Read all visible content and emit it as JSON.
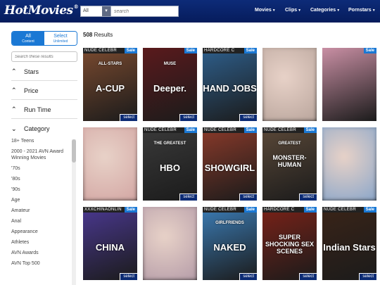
{
  "header": {
    "logo": "HotMovies",
    "logo_mark": "®",
    "search_scope": "All",
    "search_placeholder": "search",
    "nav": [
      "Movies",
      "Clips",
      "Categories",
      "Pornstars"
    ]
  },
  "sidebar": {
    "tab_all": "All",
    "tab_all_sub": "Content",
    "tab_select": "Select",
    "tab_select_sub": "Unlimited",
    "filter_placeholder": "Search these results",
    "facets": [
      "Stars",
      "Price",
      "Run Time",
      "Category"
    ],
    "categories": [
      "18+ Teens",
      "2000 - 2021 AVN Award Winning Movies",
      "'70s",
      "'80s",
      "'90s",
      "Age",
      "Amateur",
      "Anal",
      "Appearance",
      "Athletes",
      "AVN Awards",
      "AVN Top 500"
    ]
  },
  "main": {
    "results_count": "508",
    "results_label": "Results",
    "sale_label": "Sale",
    "select_label": "select",
    "cards": [
      {
        "ribbon": "NUDE CELEBR",
        "title": "A-CUP",
        "sub": "ALL-STARS",
        "bg": "#7a4a2f",
        "sale": true,
        "select": true,
        "blur": false
      },
      {
        "ribbon": "",
        "title": "Deeper.",
        "sub": "MUSE",
        "bg": "#5a1a1c",
        "sale": true,
        "select": true,
        "blur": false
      },
      {
        "ribbon": "HARDCORE C",
        "title": "HAND JOBS",
        "sub": "",
        "bg": "#2e5f8c",
        "sale": true,
        "select": true,
        "blur": false
      },
      {
        "ribbon": "",
        "title": "",
        "sub": "",
        "bg": "#b9a59c",
        "sale": false,
        "select": false,
        "blur": true
      },
      {
        "ribbon": "",
        "title": "",
        "sub": "",
        "bg": "#c98fa4",
        "sale": true,
        "select": false,
        "blur": false
      },
      {
        "ribbon": "",
        "title": "",
        "sub": "",
        "bg": "#d3a6a3",
        "sale": false,
        "select": false,
        "blur": true
      },
      {
        "ribbon": "NUDE CELEBR",
        "title": "HBO",
        "sub": "THE GREATEST",
        "bg": "#3a3a3a",
        "sale": true,
        "select": true,
        "blur": false
      },
      {
        "ribbon": "NUDE CELEBR",
        "title": "SHOWGIRL",
        "sub": "",
        "bg": "#8a3a2a",
        "sale": true,
        "select": true,
        "blur": false
      },
      {
        "ribbon": "NUDE CELEBR",
        "title": "MONSTER-HUMAN",
        "sub": "GREATEST",
        "bg": "#5a4838",
        "sale": true,
        "select": true,
        "blur": false
      },
      {
        "ribbon": "",
        "title": "",
        "sub": "",
        "bg": "#8aa6c9",
        "sale": false,
        "select": false,
        "blur": true
      },
      {
        "ribbon": "XXXCHINAONLIN",
        "title": "CHINA",
        "sub": "",
        "bg": "#4a3890",
        "sale": true,
        "select": true,
        "blur": false
      },
      {
        "ribbon": "",
        "title": "",
        "sub": "",
        "bg": "#b59ca8",
        "sale": false,
        "select": false,
        "blur": true
      },
      {
        "ribbon": "NUDE CELEBR",
        "title": "NAKED",
        "sub": "GIRLFRIENDS",
        "bg": "#3b7cb5",
        "sale": true,
        "select": true,
        "blur": false
      },
      {
        "ribbon": "HARDCORE C",
        "title": "SUPER SHOCKING SEX SCENES",
        "sub": "",
        "bg": "#7a2218",
        "sale": true,
        "select": true,
        "blur": false
      },
      {
        "ribbon": "NUDE CELEBR",
        "title": "Indian Stars",
        "sub": "",
        "bg": "#3a2418",
        "sale": true,
        "select": true,
        "blur": false
      }
    ]
  }
}
